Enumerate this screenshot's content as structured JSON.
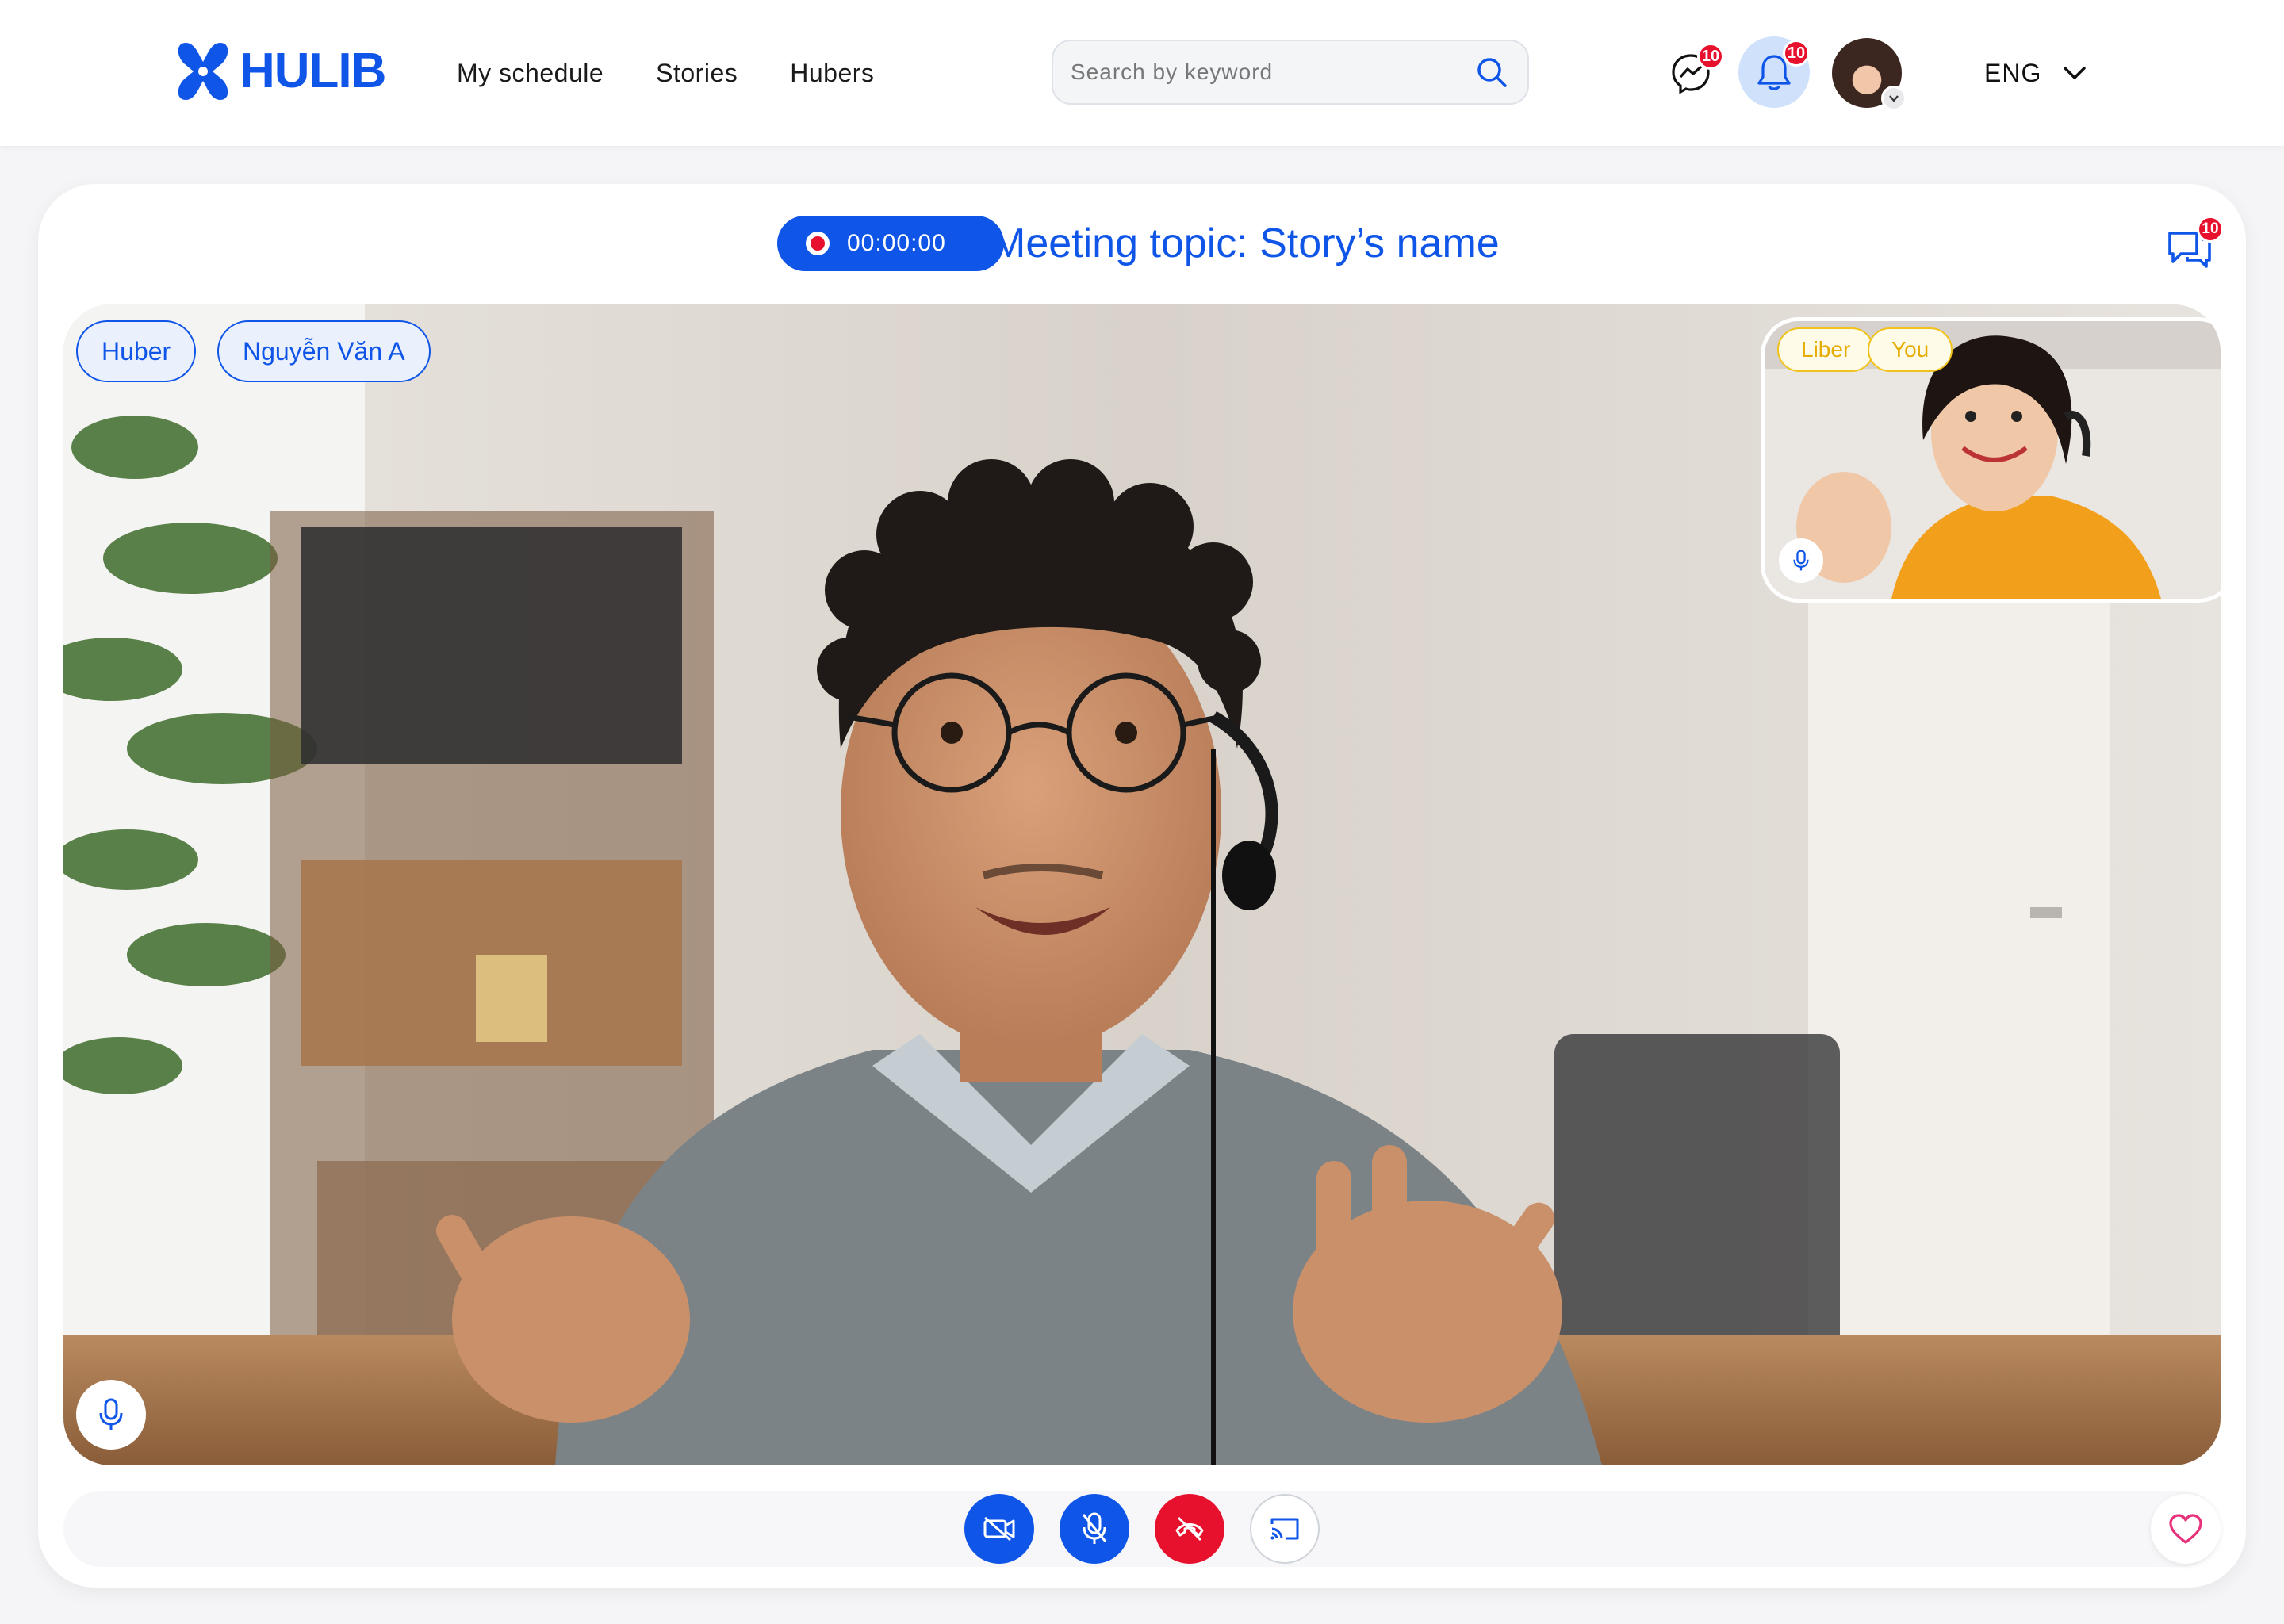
{
  "header": {
    "brand": "HULIB",
    "nav": [
      "My schedule",
      "Stories",
      "Hubers"
    ],
    "search_placeholder": "Search by keyword",
    "messages_badge": "10",
    "notifications_badge": "10",
    "language": "ENG"
  },
  "meeting": {
    "timer": "00:00:00",
    "topic": "Meeting topic: Story’s name",
    "chat_badge": "10",
    "main_tags": [
      "Huber",
      "Nguyễn Văn A"
    ],
    "pip_tags": [
      "Liber",
      "You"
    ]
  },
  "colors": {
    "brand_blue": "#0f55e8",
    "danger_red": "#e8112d",
    "pip_tag_yellow": "#f0c21b",
    "like_pink": "#e8317a"
  },
  "icons": {
    "logo": "hulib-logo-icon",
    "search": "search-icon",
    "messages": "messenger-icon",
    "notifications": "bell-icon",
    "language_caret": "chevron-down-icon",
    "record": "record-dot-icon",
    "chat": "chat-bubbles-icon",
    "mic": "microphone-icon",
    "camera_off": "video-off-icon",
    "mic_off": "microphone-off-icon",
    "hang_up": "phone-off-icon",
    "share_screen": "cast-icon",
    "like": "heart-icon"
  }
}
